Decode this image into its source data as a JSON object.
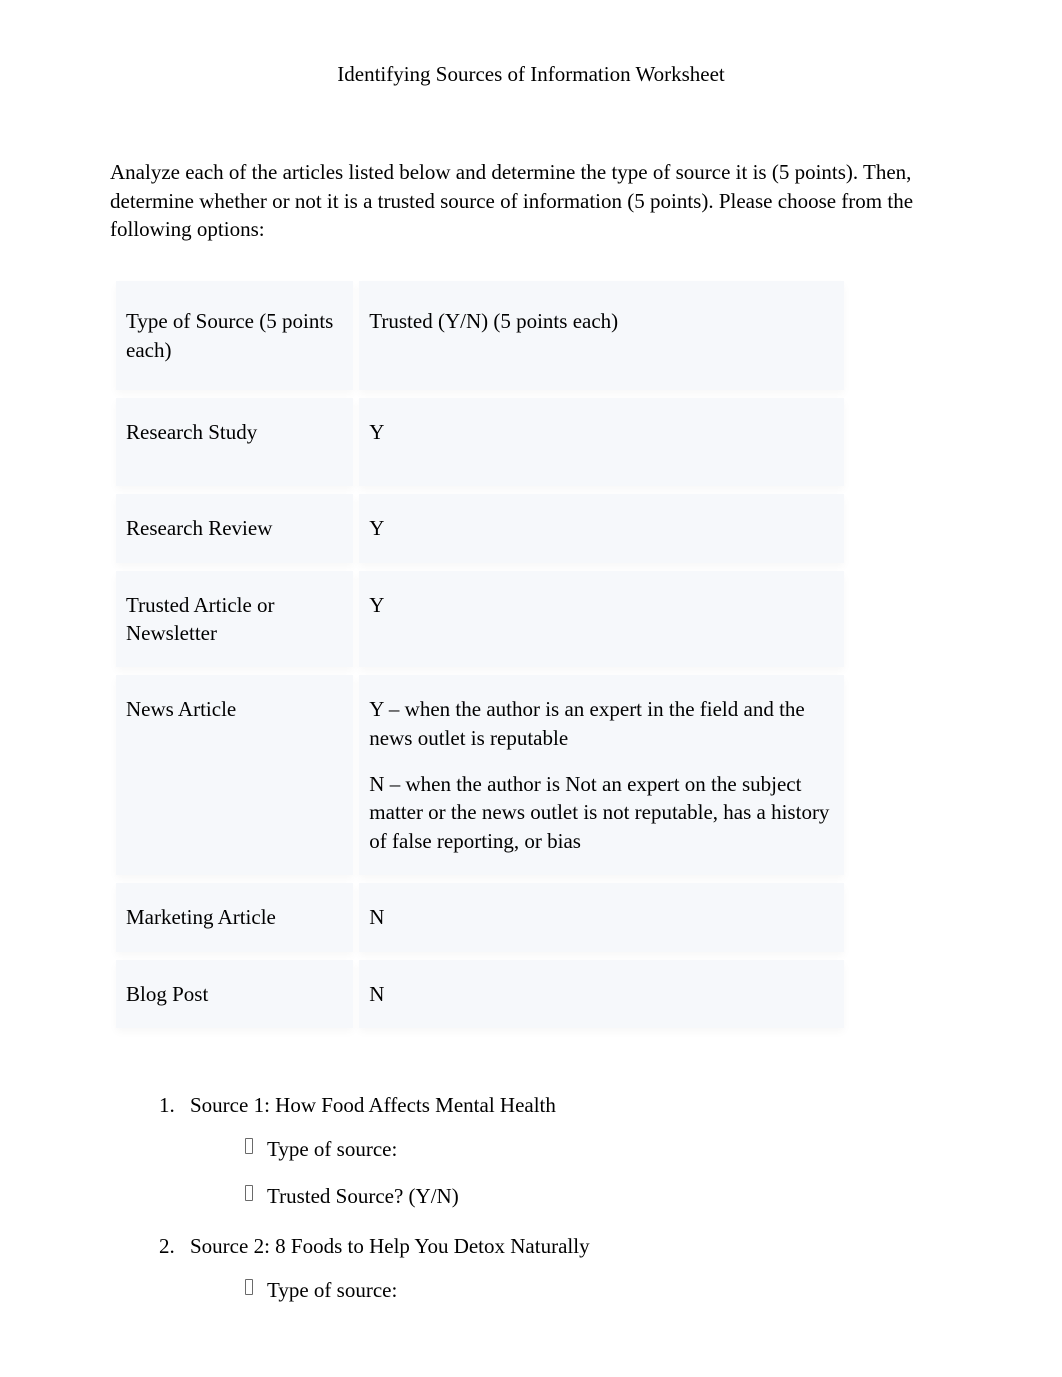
{
  "title": "Identifying Sources of Information Worksheet",
  "intro": "Analyze each of the articles listed below and determine the type of source it is (5 points). Then, determine whether or not it is a trusted source of information (5 points). Please choose from the following options:",
  "table": {
    "header": {
      "col1": "Type of Source (5 points each)",
      "col2": "Trusted (Y/N) (5 points each)"
    },
    "rows": [
      {
        "col1": "Research Study",
        "col2": "Y"
      },
      {
        "col1": "Research Review",
        "col2": "Y"
      },
      {
        "col1": "Trusted Article or Newsletter",
        "col2": "Y"
      },
      {
        "col1": "News Article",
        "col2_p1": "Y – when the author is an expert in the field and the news outlet is reputable",
        "col2_p2": "N – when the author is Not an expert on the subject matter or the news outlet is not reputable, has a history of false reporting, or bias"
      },
      {
        "col1": "Marketing Article",
        "col2": "N"
      },
      {
        "col1": "Blog Post",
        "col2": "N"
      }
    ]
  },
  "sources": [
    {
      "label": "Source 1: How Food Affects Mental Health",
      "sub": [
        "Type of source:",
        "Trusted Source? (Y/N)"
      ]
    },
    {
      "label": "Source 2: 8 Foods to Help You Detox Naturally",
      "sub": [
        "Type of source:"
      ]
    }
  ]
}
